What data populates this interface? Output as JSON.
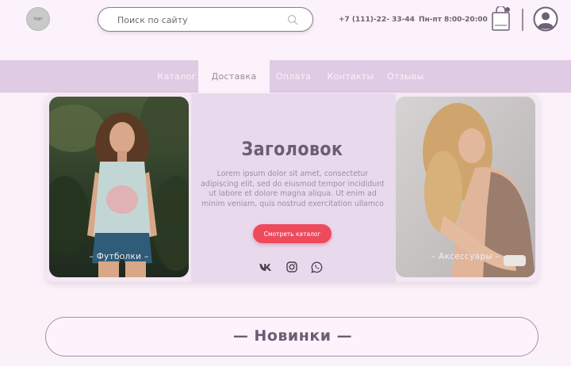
{
  "header": {
    "logo_text": "logo",
    "search": {
      "placeholder": "Поиск по сайту",
      "value": ""
    },
    "phone": "+7 (111)-22- 33-44",
    "hours": "Пн-пт 8:00-20:00",
    "icons": {
      "search": "search-icon",
      "cart": "shopping-bag-icon",
      "profile": "user-icon"
    }
  },
  "nav": {
    "items": [
      {
        "label": "Каталог",
        "active": false
      },
      {
        "label": "Доставка",
        "active": true
      },
      {
        "label": "Оплата",
        "active": false
      },
      {
        "label": "Контакты",
        "active": false
      },
      {
        "label": "Отзывы",
        "active": false
      }
    ]
  },
  "hero": {
    "title": "Заголовок",
    "text": "Lorem ipsum dolor sit amet, consectetur adipiscing elit, sed do eiusmod tempor incididunt ut labore et dolore magna aliqua. Ut enim ad minim veniam, quis nostrud exercitation ullamco",
    "cta_label": "Смотреть каталог",
    "left_card": {
      "caption": "– Футболки –"
    },
    "right_card": {
      "caption": "– Аксессуары –"
    },
    "social": [
      "vk-icon",
      "instagram-icon",
      "whatsapp-icon"
    ]
  },
  "new_section": {
    "title": "— Новинки —"
  },
  "colors": {
    "background": "#faf1f9",
    "nav": "#e0cbe4",
    "accent": "#ee4a5c",
    "text_dark": "#6e5d72"
  }
}
